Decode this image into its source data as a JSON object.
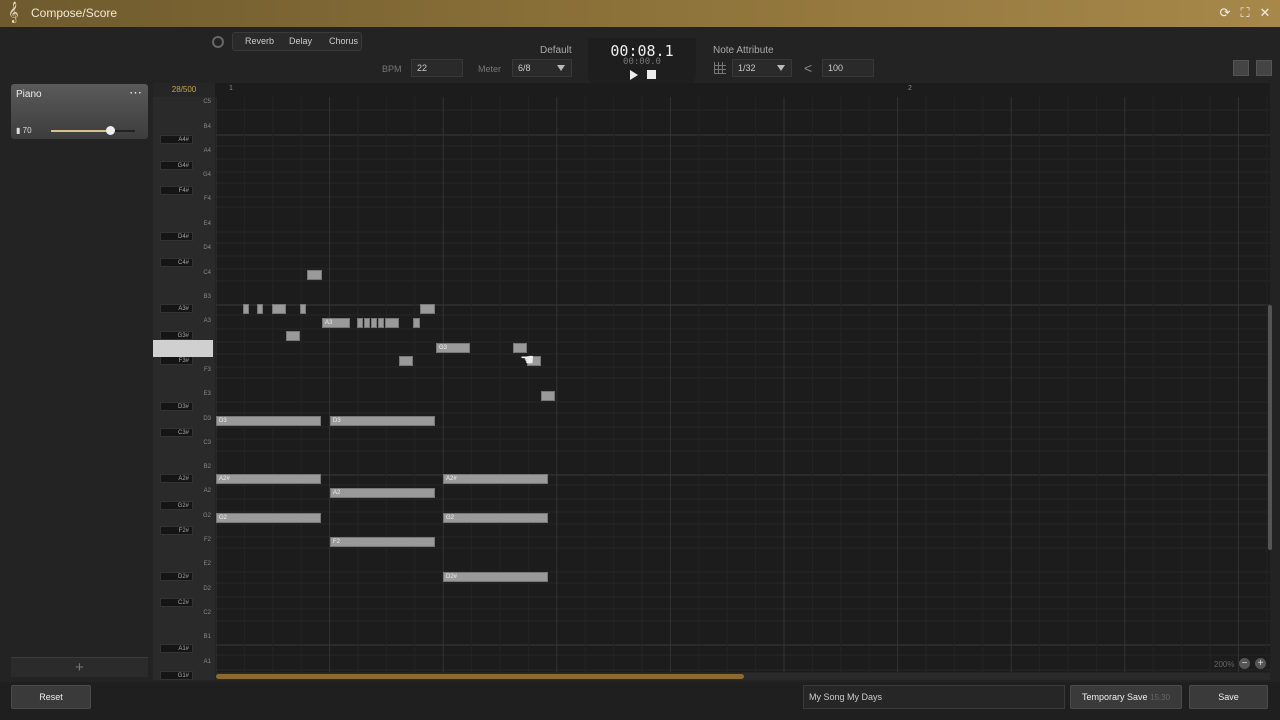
{
  "window": {
    "title": "Compose/Score"
  },
  "toolbar": {
    "effects": [
      "Reverb",
      "Delay",
      "Chorus"
    ],
    "bpm_label": "BPM",
    "bpm_value": "22",
    "meter_label": "Meter",
    "meter_value": "6/8",
    "preset_label": "Default",
    "time_main": "00:08.1",
    "time_sub": "00:00.0",
    "note_attr_label": "Note Attribute",
    "grid_value": "1/32",
    "velocity_value": "100"
  },
  "track": {
    "name": "Piano",
    "volume": "70",
    "volume_fraction": 0.7
  },
  "ruler": {
    "counter": "28/500",
    "measures": [
      "1",
      "2"
    ]
  },
  "keys": {
    "white": [
      "C5",
      "B4",
      "A4",
      "G4",
      "F4",
      "E4",
      "D4",
      "C4",
      "B3",
      "A3",
      "G3",
      "F3",
      "E3",
      "D3",
      "C3",
      "B2",
      "A2",
      "G2",
      "F2",
      "E2",
      "D2",
      "C2",
      "B1",
      "A1"
    ],
    "black": [
      "A4#",
      "G4#",
      "F4#",
      "D4#",
      "C4#",
      "A3#",
      "G3#",
      "F3#",
      "D3#",
      "C3#",
      "A2#",
      "G2#",
      "F2#",
      "D2#",
      "C2#",
      "A1#",
      "G1#"
    ],
    "selected": "G3"
  },
  "notes": [
    {
      "pitch": "C4",
      "label": ""
    },
    {
      "pitch": "A3#",
      "label": ""
    },
    {
      "pitch": "A3#",
      "label": ""
    },
    {
      "pitch": "A3#",
      "label": ""
    },
    {
      "pitch": "A3#",
      "label": ""
    },
    {
      "pitch": "A3#",
      "label": ""
    },
    {
      "pitch": "A3",
      "label": "A3"
    },
    {
      "pitch": "A3",
      "label": ""
    },
    {
      "pitch": "A3",
      "label": ""
    },
    {
      "pitch": "A3",
      "label": ""
    },
    {
      "pitch": "A3",
      "label": ""
    },
    {
      "pitch": "A3",
      "label": ""
    },
    {
      "pitch": "A3",
      "label": ""
    },
    {
      "pitch": "G3#",
      "label": ""
    },
    {
      "pitch": "G3",
      "label": "G3"
    },
    {
      "pitch": "G3",
      "label": ""
    },
    {
      "pitch": "F3#",
      "label": ""
    },
    {
      "pitch": "F3#",
      "label": ""
    },
    {
      "pitch": "E3",
      "label": ""
    },
    {
      "pitch": "D3",
      "label": "D3"
    },
    {
      "pitch": "D3",
      "label": "D3"
    },
    {
      "pitch": "A2#",
      "label": "A2#"
    },
    {
      "pitch": "A2#",
      "label": "A2#"
    },
    {
      "pitch": "A2",
      "label": "A2"
    },
    {
      "pitch": "G2",
      "label": "G2"
    },
    {
      "pitch": "G2",
      "label": "G2"
    },
    {
      "pitch": "F2",
      "label": "F2"
    },
    {
      "pitch": "D2#",
      "label": "D2#"
    }
  ],
  "zoom": "200%",
  "footer": {
    "reset": "Reset",
    "song_name": "My Song My Days",
    "temp_save": "Temporary Save",
    "temp_save_time": "15:30",
    "save": "Save"
  },
  "colors": {
    "accent": "#c9a24d",
    "titlebar": "#8a7038",
    "note": "#9a9a9a"
  }
}
